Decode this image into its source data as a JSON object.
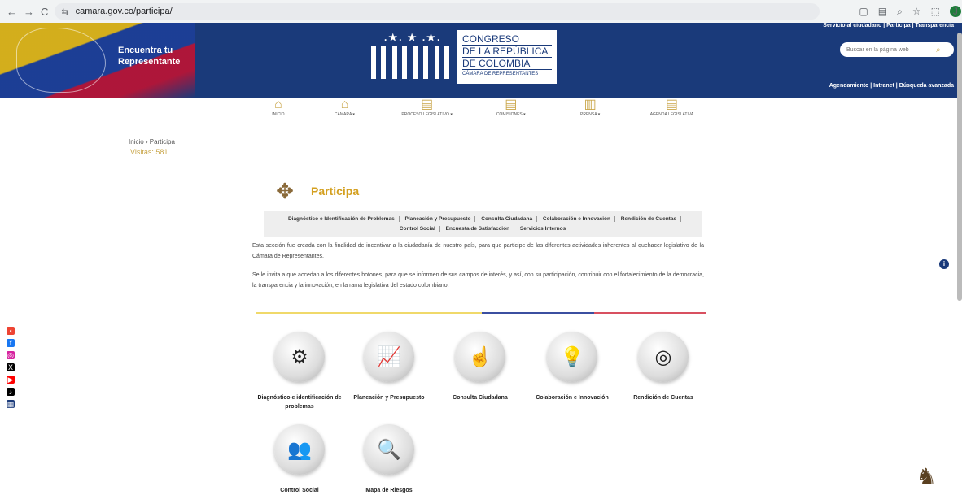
{
  "browser": {
    "url": "camara.gov.co/participa/",
    "back_icon": "←",
    "forward_icon": "→",
    "reload_icon": "C",
    "tune_icon": "⇆",
    "ext_icons": [
      "▢",
      "▤",
      "⌕",
      "☆",
      "⬚",
      "⋮"
    ],
    "avatar_letter": "J"
  },
  "header": {
    "encuentra": "Encuentra tu",
    "representante": "Representante",
    "stars": ".★. ★ .★.",
    "logo_lines": [
      "CONGRESO",
      "DE LA REPÚBLICA",
      "DE COLOMBIA"
    ],
    "logo_sub": "CÁMARA DE REPRESENTANTES",
    "top_links": "Servicio al ciudadano | Participa | Transparencia",
    "search_placeholder": "Buscar en la página web",
    "search_icon": "⌕",
    "bottom_links": "Agendamiento | Intranet | Búsqueda avanzada"
  },
  "nav": [
    {
      "label": "INICIO",
      "icon": "⌂"
    },
    {
      "label": "CÁMARA ▾",
      "icon": "⌂"
    },
    {
      "label": "PROCESO LEGISLATIVO ▾",
      "icon": "▤"
    },
    {
      "label": "COMISIONES ▾",
      "icon": "▤"
    },
    {
      "label": "PRENSA ▾",
      "icon": "▥"
    },
    {
      "label": "AGENDA LEGISLATIVA",
      "icon": "▤"
    }
  ],
  "breadcrumb": {
    "home": "Inicio",
    "sep": " › ",
    "current": "Participa"
  },
  "visitas": "Visitas: 581",
  "page": {
    "title": "Participa",
    "icon": "✥",
    "subnav_row1": [
      "Diagnóstico e Identificación de Problemas",
      "Planeación y Presupuesto",
      "Consulta Ciudadana",
      "Colaboración e Innovación",
      "Rendición de Cuentas"
    ],
    "subnav_row2": [
      "Control Social",
      "Encuesta de Satisfacción",
      "Servicios Internos"
    ],
    "paragraph1": "Esta sección fue creada con la finalidad de incentivar a la ciudadanía de nuestro país, para que participe de las diferentes actividades inherentes al quehacer legislativo de la Cámara de Representantes.",
    "paragraph2": "Se le invita a que accedan a los diferentes botones, para que se informen de sus campos de interés, y así, con su participación, contribuir con el fortalecimiento de la democracia, la transparencia y la innovación, en la rama legislativa del estado colombiano."
  },
  "cards": [
    {
      "label": "Diagnóstico e identificación de problemas",
      "icon": "⚙"
    },
    {
      "label": "Planeación y Presupuesto",
      "icon": "📈"
    },
    {
      "label": "Consulta Ciudadana",
      "icon": "☝"
    },
    {
      "label": "Colaboración e Innovación",
      "icon": "💡"
    },
    {
      "label": "Rendición de Cuentas",
      "icon": "◎"
    },
    {
      "label": "Control Social",
      "icon": "👥"
    },
    {
      "label": "Mapa de Riesgos",
      "icon": "🔍"
    }
  ],
  "social": [
    {
      "name": "sound",
      "icon": "◖",
      "color": "#e43"
    },
    {
      "name": "facebook",
      "icon": "f",
      "color": "#1877f2"
    },
    {
      "name": "instagram",
      "icon": "◎",
      "color": "#d6249f"
    },
    {
      "name": "x",
      "icon": "X",
      "color": "#000"
    },
    {
      "name": "youtube",
      "icon": "▶",
      "color": "#ff0000"
    },
    {
      "name": "tiktok",
      "icon": "♪",
      "color": "#000"
    },
    {
      "name": "app",
      "icon": "▦",
      "color": "#1a3a7a"
    }
  ],
  "info_icon": "i",
  "lion_icon": "♞"
}
